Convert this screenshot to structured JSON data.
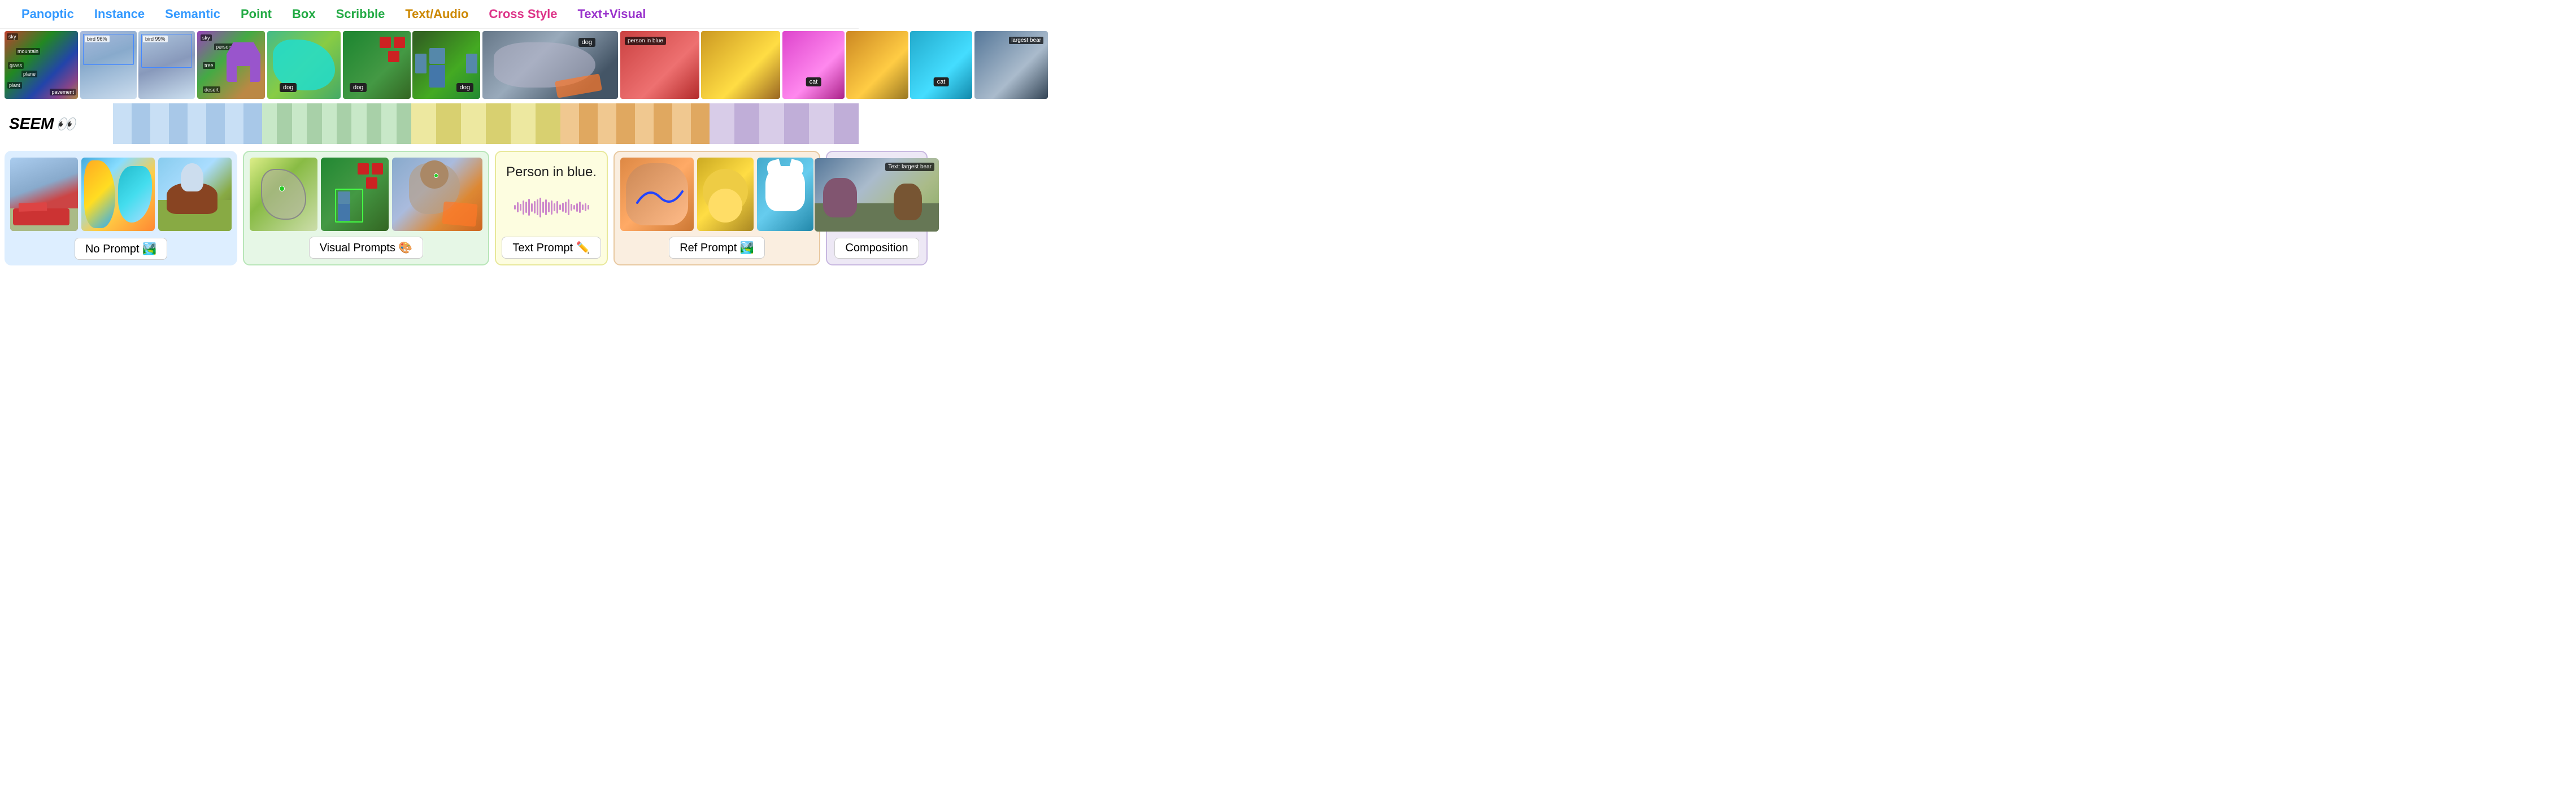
{
  "tabs": [
    {
      "label": "Panoptic",
      "color": "#3399ff"
    },
    {
      "label": "Instance",
      "color": "#3399ff"
    },
    {
      "label": "Semantic",
      "color": "#3399ff"
    },
    {
      "label": "Point",
      "color": "#22aa44"
    },
    {
      "label": "Box",
      "color": "#22aa44"
    },
    {
      "label": "Scribble",
      "color": "#22aa44"
    },
    {
      "label": "Text/Audio",
      "color": "#cc8800"
    },
    {
      "label": "Cross Style",
      "color": "#dd3388"
    },
    {
      "label": "Text+Visual",
      "color": "#9933cc"
    }
  ],
  "seem_logo": "SEEM 👀",
  "stripes": {
    "colors_light": [
      "#c8dff5",
      "#c8e8c8",
      "#fbedb0",
      "#f5c890",
      "#ddd0f0"
    ],
    "colors_mid": [
      "#a8c8e8",
      "#a8d0a8",
      "#e8d870",
      "#e8a870",
      "#c0aed8"
    ]
  },
  "panels": [
    {
      "id": "no-prompt",
      "label": "No Prompt 🏞️",
      "bg": "#ddeeff",
      "images": [
        "plane/airport scene",
        "colorful parrots",
        "astronaut on horse"
      ]
    },
    {
      "id": "visual-prompts",
      "label": "Visual Prompts 🎨",
      "bg": "#e6f7e6",
      "border": "#b8e6b8",
      "images": [
        "sketch dog",
        "minecraft boxes with point",
        "astronaut cat in space"
      ]
    },
    {
      "id": "text-prompt",
      "label": "Text Prompt ✏️",
      "bg": "#fdfde0",
      "border": "#e8e89a",
      "text_display": "Person in blue.",
      "waveform": true
    },
    {
      "id": "ref-prompt",
      "label": "Ref Prompt 🏞️",
      "bg": "#faeee0",
      "border": "#e8c8a0",
      "images": [
        "kitten with blue scribble",
        "doraemon yellow",
        "white cat"
      ]
    },
    {
      "id": "composition",
      "label": "Composition",
      "bg": "#ede8f5",
      "border": "#c8b8e0",
      "images": [
        "bears on rocks with text label"
      ]
    }
  ],
  "top_images": {
    "panoptic": {
      "count": 1,
      "bg": "#b04030"
    },
    "instance": {
      "count": 2,
      "bg": "#88aacc"
    },
    "semantic": {
      "count": 1,
      "bg": "#8844aa"
    },
    "point": {
      "count": 1,
      "bg": "#44aa88"
    },
    "box": {
      "count": 2,
      "bg": "#336633"
    },
    "scribble": {
      "count": 1,
      "bg": "#778899"
    },
    "text_audio": {
      "count": 2,
      "bg": "#cc4444"
    },
    "cross_style": {
      "count": 3,
      "bg": "#cc44cc"
    },
    "text_visual": {
      "count": 1,
      "bg": "#556677"
    }
  }
}
